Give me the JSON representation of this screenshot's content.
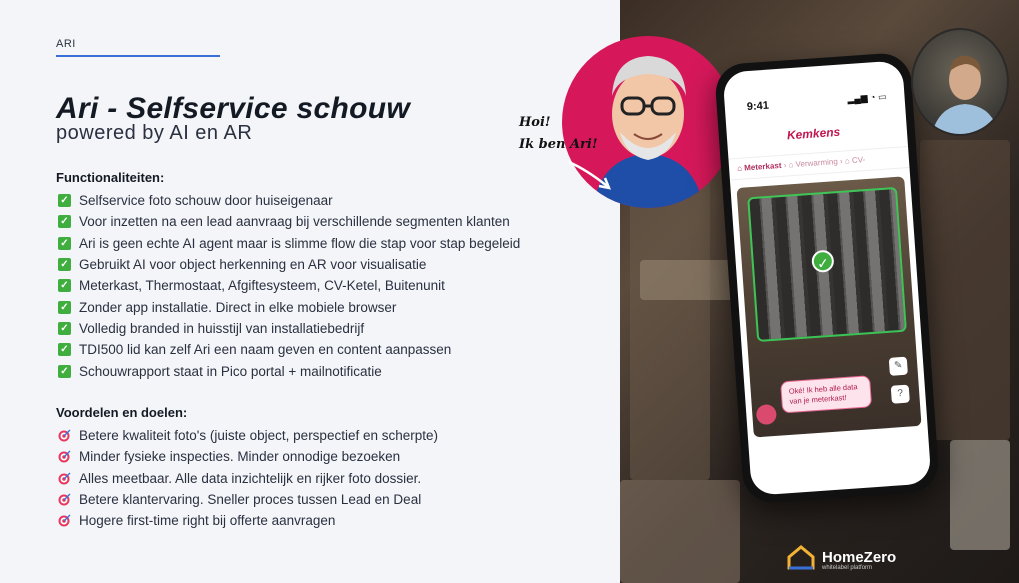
{
  "slide": {
    "section_tag": "ARI",
    "title": "Ari - Selfservice schouw",
    "subtitle": "powered by AI en AR",
    "features": {
      "heading": "Functionaliteiten:",
      "items": [
        "Selfservice foto schouw door huiseigenaar",
        "Voor inzetten na een lead aanvraag bij verschillende segmenten klanten",
        "Ari is geen echte AI agent maar is slimme flow die stap voor stap begeleid",
        "Gebruikt AI voor object herkenning en AR voor visualisatie",
        "Meterkast, Thermostaat, Afgiftesysteem, CV-Ketel, Buitenunit",
        "Zonder app installatie. Direct in elke mobiele browser",
        "Volledig branded in huisstijl van installatiebedrijf",
        "TDI500 lid kan zelf Ari een naam geven en content aanpassen",
        "Schouwrapport staat in Pico portal + mailnotificatie"
      ]
    },
    "benefits": {
      "heading": "Voordelen en doelen:",
      "items": [
        "Betere kwaliteit foto's (juiste object, perspectief en scherpte)",
        "Minder fysieke inspecties. Minder onnodige bezoeken",
        "Alles meetbaar. Alle data inzichtelijk en rijker foto dossier.",
        "Betere klantervaring. Sneller proces tussen Lead en Deal",
        "Hogere first-time right bij offerte aanvragen"
      ]
    }
  },
  "mascot": {
    "greeting_line1": "Hoi!",
    "greeting_line2": "Ik ben Ari!"
  },
  "phone": {
    "time": "9:41",
    "brand": "Kemkens",
    "crumb_active": "Meterkast",
    "crumb_2": "Verwarming",
    "crumb_3": "CV-",
    "chat_message": "Oké! Ik heb alle data van je meterkast!"
  },
  "logo": {
    "name": "HomeZero",
    "tagline": "whitelabel platform"
  },
  "colors": {
    "accent_blue": "#3a6fd8",
    "check_green": "#3fae3f",
    "brand_pink": "#d6185a"
  }
}
